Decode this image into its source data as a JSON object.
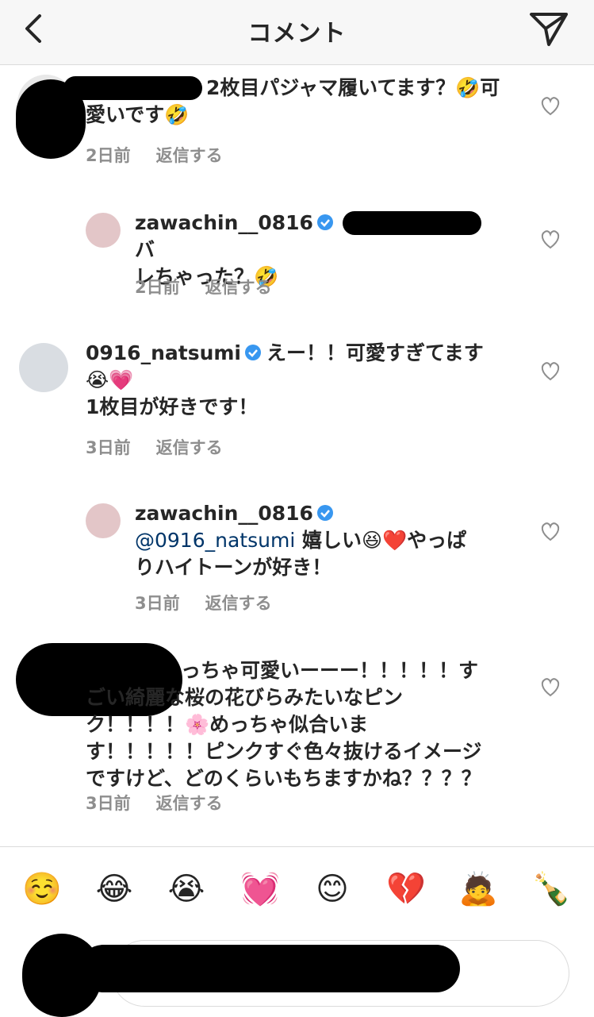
{
  "header": {
    "back_icon": "chevron-left-icon",
    "title": "コメント",
    "send_icon": "paper-plane-icon"
  },
  "comments": [
    {
      "username": "",
      "text": "2枚目パジャマ履いてます？🤣可愛いです🤣",
      "time": "2日前",
      "reply": "返信する"
    },
    {
      "username": "zawachin__0816",
      "verified": true,
      "text_a": "バ",
      "text_b": "レちゃった？🤣",
      "time": "2日前",
      "reply": "返信する"
    },
    {
      "username": "0916_natsumi",
      "verified": true,
      "text_a": "えー！！可愛すぎてます",
      "text_b": "😭💗",
      "text_c": "1枚目が好きです！",
      "time": "3日前",
      "reply": "返信する"
    },
    {
      "username": "zawachin__0816",
      "verified": true,
      "mention": "@0916_natsumi",
      "text_a": " 嬉しい😆❤️やっぱ",
      "text_b": "りハイトーンが好き！",
      "time": "3日前",
      "reply": "返信する"
    },
    {
      "username": "",
      "line1": "っちゃ可愛いーーー！！！！！す",
      "line2": "ごい綺麗な桜の花びらみたいなピン",
      "line3": "ク！！！！🌸めっちゃ似合いま",
      "line4": "す！！！！！ピンクすぐ色々抜けるイメージ",
      "line5": "ですけど、どのくらいもちますかね？？？？",
      "time": "3日前",
      "reply": "返信する"
    }
  ],
  "emoji_bar": [
    "☺️",
    "😂",
    "😭",
    "💓",
    "😊",
    "💔",
    "🙇",
    "🍾"
  ],
  "input": {
    "placeholder": ""
  },
  "colors": {
    "text": "#262626",
    "meta": "#8e8e8e",
    "verified": "#3897f0",
    "mention": "#003569"
  }
}
